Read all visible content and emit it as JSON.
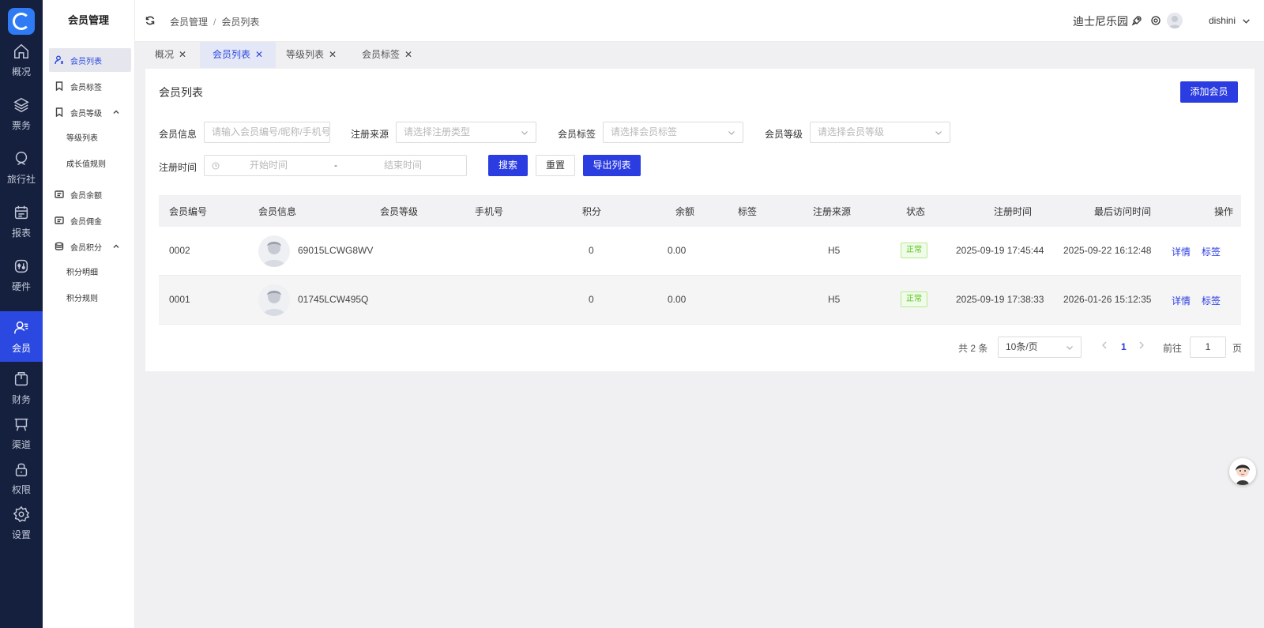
{
  "rail": {
    "items": [
      {
        "label": "概况",
        "icon": "home-icon"
      },
      {
        "label": "票务",
        "icon": "layers-icon"
      },
      {
        "label": "旅行社",
        "icon": "travel-agency-icon"
      },
      {
        "label": "报表",
        "icon": "calendar-report-icon"
      },
      {
        "label": "硬件",
        "icon": "hardware-icon"
      },
      {
        "label": "会员",
        "icon": "member-icon"
      },
      {
        "label": "财务",
        "icon": "wallet-icon"
      },
      {
        "label": "渠道",
        "icon": "channel-icon"
      },
      {
        "label": "权限",
        "icon": "lock-icon"
      },
      {
        "label": "设置",
        "icon": "gear-icon"
      }
    ],
    "active_index": 5
  },
  "submenu": {
    "title": "会员管理",
    "items": [
      {
        "label": "会员列表",
        "icon": "user-list-icon"
      },
      {
        "label": "会员标签",
        "icon": "bookmark-icon"
      },
      {
        "label": "会员等级",
        "icon": "bookmark-icon"
      },
      {
        "label": "等级列表"
      },
      {
        "label": "成长值规则"
      },
      {
        "label": "会员余额",
        "icon": "balance-icon"
      },
      {
        "label": "会员佣金",
        "icon": "commission-icon"
      },
      {
        "label": "会员积分",
        "icon": "points-icon"
      },
      {
        "label": "积分明细"
      },
      {
        "label": "积分规则"
      }
    ]
  },
  "header": {
    "breadcrumb": [
      "会员管理",
      "会员列表"
    ],
    "breadcrumb_sep": "/",
    "venue": "迪士尼乐园",
    "username": "dishini"
  },
  "tabs": [
    {
      "label": "概况",
      "close": "✕"
    },
    {
      "label": "会员列表",
      "close": "✕"
    },
    {
      "label": "等级列表",
      "close": "✕"
    },
    {
      "label": "会员标签",
      "close": "✕"
    }
  ],
  "active_tab": 1,
  "page": {
    "title": "会员列表",
    "add_button": "添加会员"
  },
  "filters": {
    "member_info": {
      "label": "会员信息",
      "placeholder": "请输入会员编号/昵称/手机号"
    },
    "reg_source": {
      "label": "注册来源",
      "placeholder": "请选择注册类型"
    },
    "member_tag": {
      "label": "会员标签",
      "placeholder": "请选择会员标签"
    },
    "member_level": {
      "label": "会员等级",
      "placeholder": "请选择会员等级"
    },
    "reg_time": {
      "label": "注册时间",
      "start_placeholder": "开始时间",
      "separator": "-",
      "end_placeholder": "结束时间"
    },
    "search_button": "搜索",
    "reset_button": "重置",
    "export_button": "导出列表"
  },
  "table": {
    "columns": [
      "会员编号",
      "会员信息",
      "会员等级",
      "手机号",
      "积分",
      "余额",
      "标签",
      "注册来源",
      "状态",
      "注册时间",
      "最后访问时间",
      "操作"
    ],
    "rows": [
      {
        "id": "0002",
        "nickname": "69015LCWG8WV",
        "level": "",
        "phone": "",
        "points": "0",
        "balance": "0.00",
        "tag": "",
        "source": "H5",
        "status": "正常",
        "reg_time": "2025-09-19 17:45:44",
        "last_visit": "2025-09-22 16:12:48",
        "actions": [
          "详情",
          "标签"
        ]
      },
      {
        "id": "0001",
        "nickname": "01745LCW495Q",
        "level": "",
        "phone": "",
        "points": "0",
        "balance": "0.00",
        "tag": "",
        "source": "H5",
        "status": "正常",
        "reg_time": "2025-09-19 17:38:33",
        "last_visit": "2026-01-26 15:12:35",
        "actions": [
          "详情",
          "标签"
        ]
      }
    ]
  },
  "pagination": {
    "total": "共 2 条",
    "page_size": "10条/页",
    "current": "1",
    "goto_label": "前往",
    "goto_value": "1",
    "goto_unit": "页"
  },
  "colors": {
    "primary": "#2b3ce0",
    "rail_bg": "#15203e",
    "status_green": "#52c41a"
  }
}
